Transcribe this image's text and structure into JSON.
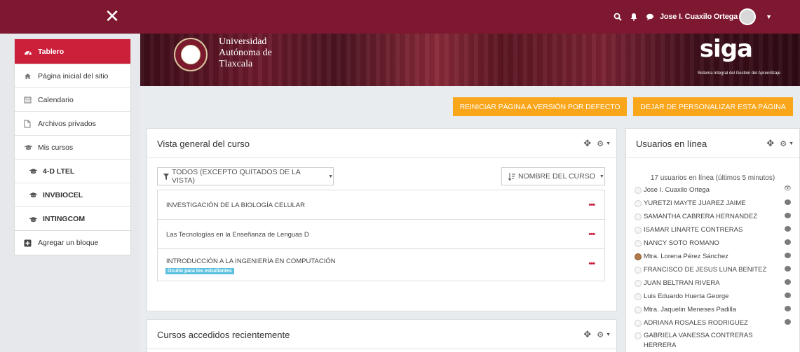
{
  "header": {
    "close_glyph": "✕",
    "user_name": "Jose I. Cuaxilo Ortega",
    "icons": [
      "search-icon",
      "bell-icon",
      "chat-icon"
    ],
    "color": "#7e1730"
  },
  "sidebar": {
    "main": [
      {
        "label": "Tablero",
        "icon": "dashboard-icon",
        "active": true
      },
      {
        "label": "Página inicial del sitio",
        "icon": "home-icon"
      },
      {
        "label": "Calendario",
        "icon": "calendar-icon"
      },
      {
        "label": "Archivos privados",
        "icon": "file-icon"
      },
      {
        "label": "Mis cursos",
        "icon": "graduation-cap-icon"
      },
      {
        "label": "4-D LTEL",
        "icon": "graduation-cap-icon"
      },
      {
        "label": "INVBIOCEL",
        "icon": "graduation-cap-icon"
      },
      {
        "label": "INTINGCOM",
        "icon": "graduation-cap-icon"
      }
    ],
    "add_block": "Agregar un bloque",
    "active_color": "#cc1f3a"
  },
  "banner": {
    "university": "Universidad\nAutónoma de\nTlaxcala",
    "logo": "siga",
    "logo_subtitle": "Sistema Integral del Gestión del Aprendizaje"
  },
  "actions": {
    "reset": "REINICIAR PÁGINA A VERSIÓN POR DEFECTO",
    "stop": "DEJAR DE PERSONALIZAR ESTA PÁGINA",
    "color": "#f9a61a"
  },
  "course_overview": {
    "title": "Vista general del curso",
    "filter": "TODOS (EXCEPTO QUITADOS DE LA VISTA)",
    "sort": "NOMBRE DEL CURSO",
    "courses": [
      {
        "name": "INVESTIGACIÓN DE LA BIOLOGÍA CELULAR"
      },
      {
        "name": "Las Tecnologías en la Enseñanza de Lenguas D"
      },
      {
        "name": "INTRODUCCIÓN A LA INGENIERÍA EN COMPUTACIÓN",
        "badge": "Oculto para los estudiantes"
      }
    ]
  },
  "recent_courses": {
    "title": "Cursos accedidos recientemente"
  },
  "online_users": {
    "title": "Usuarios en línea",
    "summary": "17 usuarios en línea (últimos 5 minutos)",
    "users": [
      {
        "name": "Jose I. Cuaxilo Ortega",
        "status": "eye"
      },
      {
        "name": "YURETZI MAYTE JUAREZ JAIME",
        "status": "msg"
      },
      {
        "name": "SAMANTHA CABRERA HERNANDEZ",
        "status": "msg"
      },
      {
        "name": "ISAMAR LINARTE CONTRERAS",
        "status": "msg"
      },
      {
        "name": "NANCY SOTO ROMANO",
        "status": "msg"
      },
      {
        "name": "Mtra. Lorena Pérez Sánchez",
        "status": "msg",
        "photo": true
      },
      {
        "name": "FRANCISCO DE JESUS LUNA BENITEZ",
        "status": "msg"
      },
      {
        "name": "JUAN BELTRAN RIVERA",
        "status": "msg"
      },
      {
        "name": "Luis Eduardo Huerta George",
        "status": "msg"
      },
      {
        "name": "Mtra. Jaquelin Meneses Padilla",
        "status": "msg"
      },
      {
        "name": "ADRIANA ROSALES RODRIGUEZ",
        "status": "msg"
      },
      {
        "name": "GABRIELA VANESSA CONTRERAS HERRERA",
        "status": "none"
      }
    ]
  }
}
